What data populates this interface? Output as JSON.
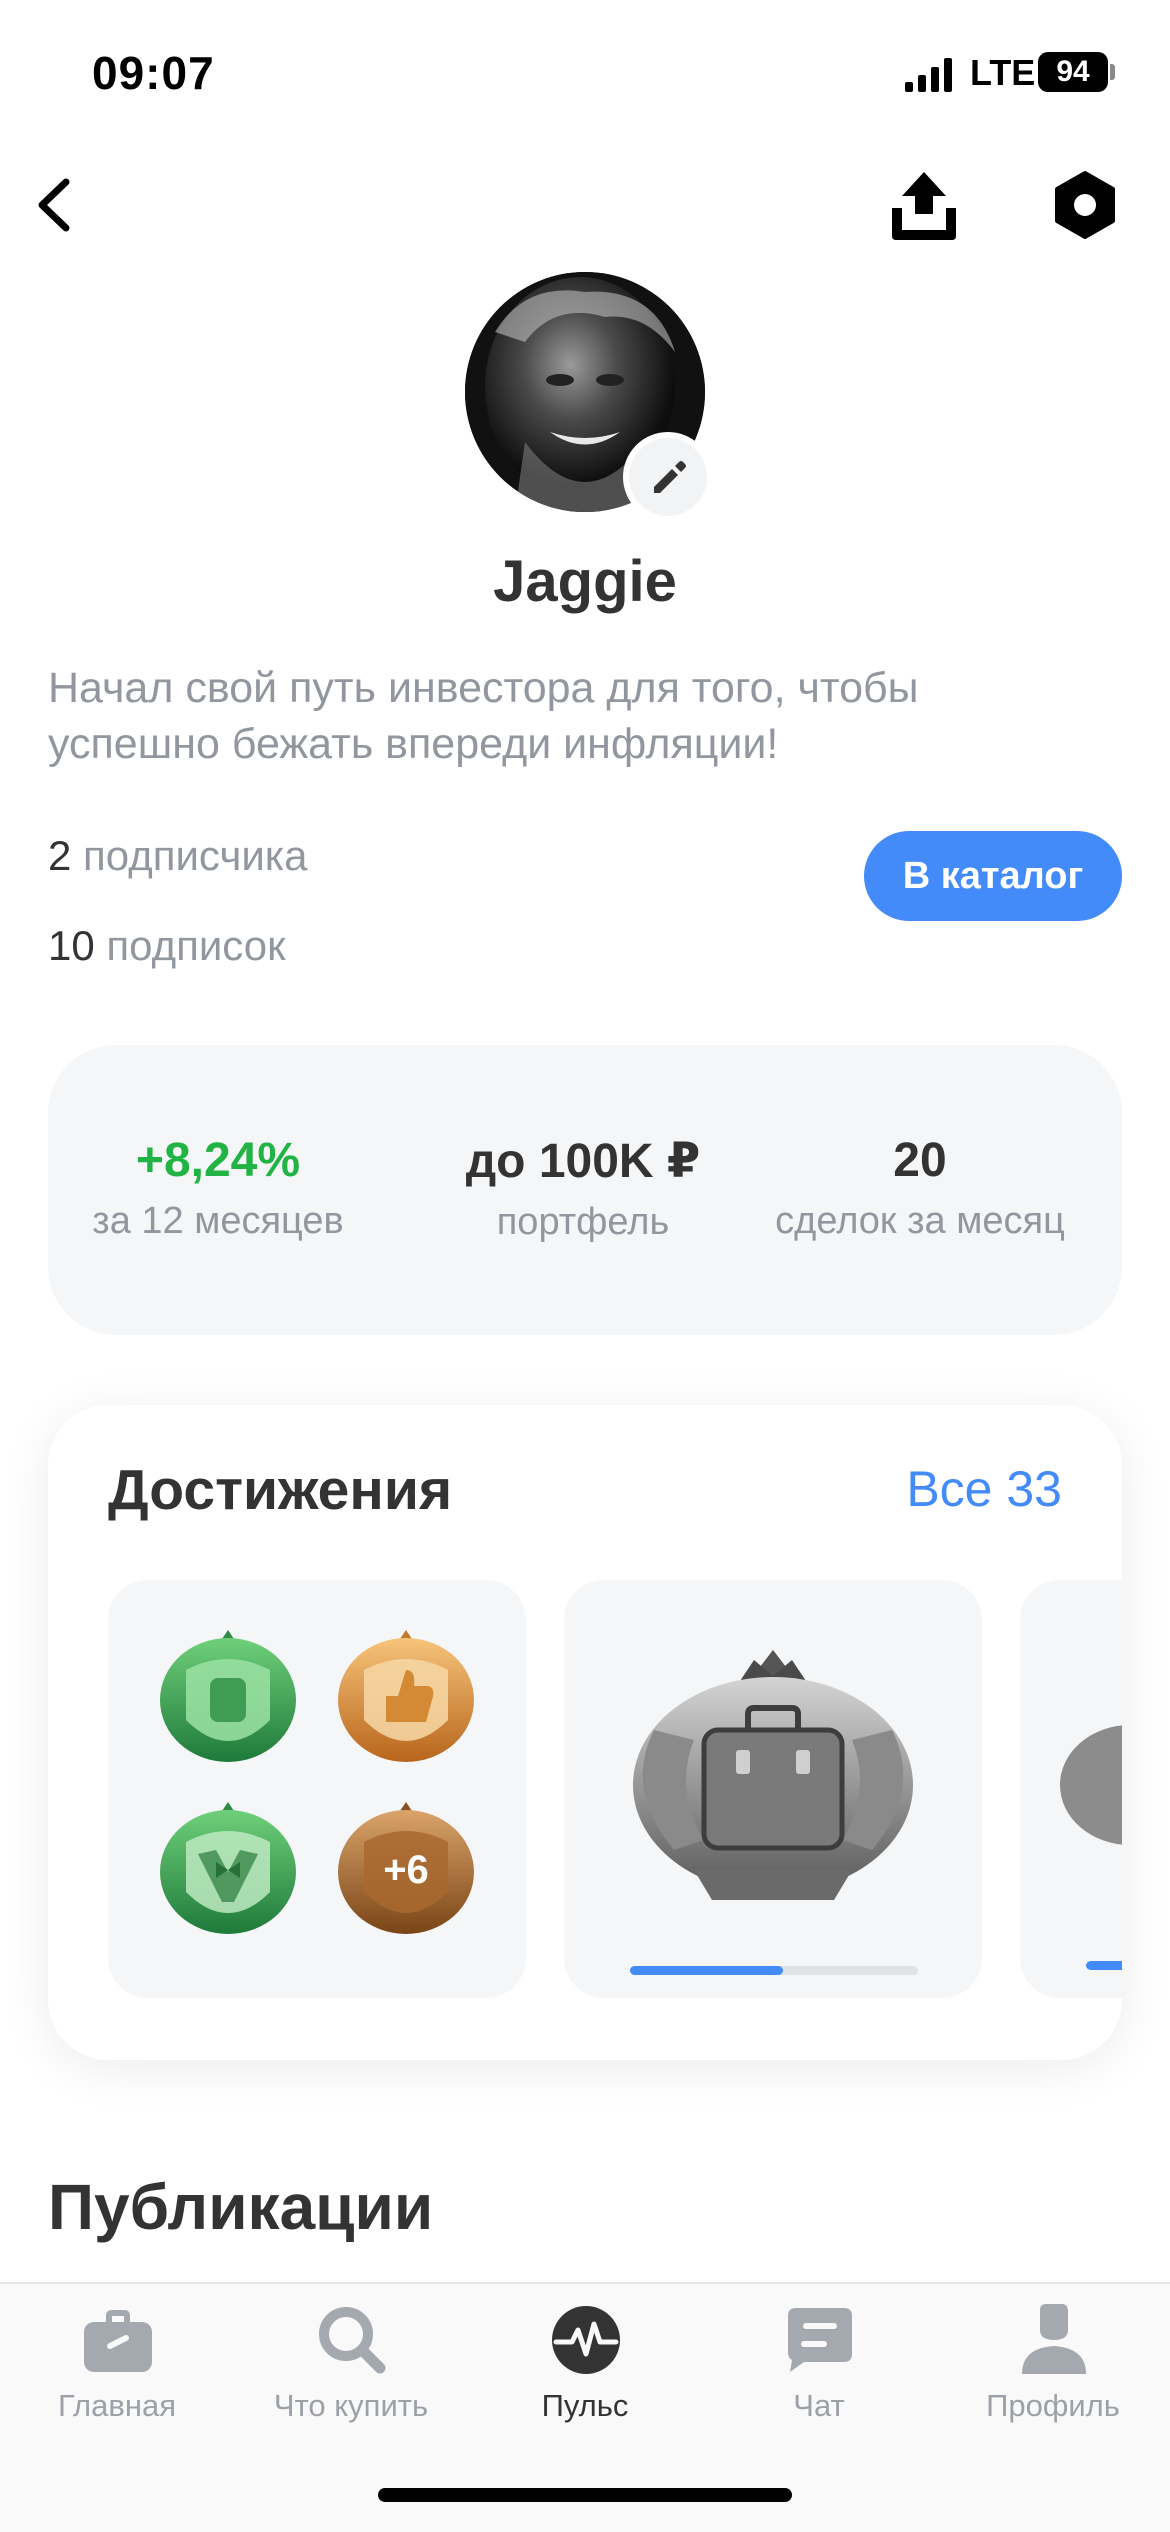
{
  "status_bar": {
    "time": "09:07",
    "network": "LTE",
    "battery": "94"
  },
  "nav": {
    "back_icon": "chevron-left-icon",
    "share_icon": "share-upload-icon",
    "settings_icon": "hexagon-settings-icon"
  },
  "profile": {
    "username": "Jaggie",
    "bio": "Начал свой путь инвестора для того, чтобы успешно бежать впереди инфляции!",
    "followers_count": "2",
    "followers_label": "подписчика",
    "following_count": "10",
    "following_label": "подписок",
    "catalog_button": "В каталог",
    "edit_icon": "pencil-icon"
  },
  "metrics": [
    {
      "value": "+8,24%",
      "label": "за 12 месяцев",
      "color": "#21b343"
    },
    {
      "value": "до 100K ₽",
      "label": "портфель"
    },
    {
      "value": "20",
      "label": "сделок за месяц"
    }
  ],
  "achievements": {
    "title": "Достижения",
    "all_link": "Все 33",
    "extra_badges": "+6",
    "briefcase_progress": 0.53,
    "badges": [
      "money-badge-icon",
      "thumbs-up-badge-icon",
      "tuxedo-badge-icon",
      "more-badge-icon",
      "briefcase-badge-icon"
    ]
  },
  "publications": {
    "title": "Публикации"
  },
  "tab_bar": {
    "tabs": [
      {
        "label": "Главная",
        "icon": "briefcase-icon",
        "active": false
      },
      {
        "label": "Что купить",
        "icon": "search-icon",
        "active": false
      },
      {
        "label": "Пульс",
        "icon": "pulse-icon",
        "active": true
      },
      {
        "label": "Чат",
        "icon": "chat-icon",
        "active": false
      },
      {
        "label": "Профиль",
        "icon": "profile-icon",
        "active": false
      }
    ]
  },
  "colors": {
    "accent": "#428bf9",
    "positive": "#21b343",
    "muted_text": "#92979f"
  }
}
